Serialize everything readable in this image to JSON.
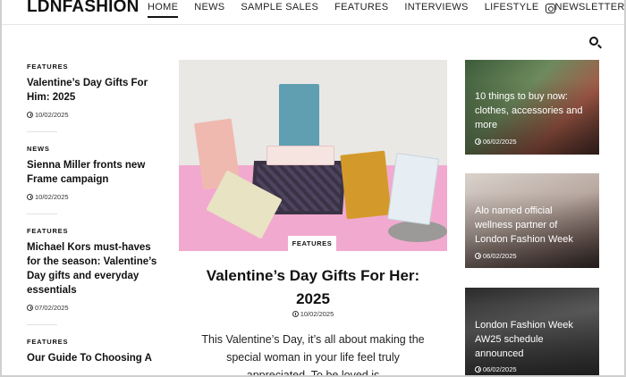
{
  "header": {
    "logo": "LDNFASHION",
    "nav": [
      "HOME",
      "NEWS",
      "SAMPLE SALES",
      "FEATURES",
      "INTERVIEWS",
      "LIFESTYLE",
      "NEWSLETTER"
    ],
    "active_nav": "HOME",
    "icons": [
      "instagram-icon",
      "search-icon"
    ]
  },
  "left_column": [
    {
      "category": "FEATURES",
      "title": "Valentine’s Day Gifts For Him: 2025",
      "date": "10/02/2025"
    },
    {
      "category": "NEWS",
      "title": "Sienna Miller fronts new Frame campaign",
      "date": "10/02/2025"
    },
    {
      "category": "FEATURES",
      "title": "Michael Kors must-haves for the season: Valentine’s Day gifts and everyday essentials",
      "date": "07/02/2025"
    },
    {
      "category": "FEATURES",
      "title": "Our Guide To Choosing A",
      "date": ""
    }
  ],
  "feature": {
    "category": "FEATURES",
    "title": "Valentine’s Day Gifts For Her: 2025",
    "date": "10/02/2025",
    "excerpt": "This Valentine’s Day, it’s all about making the special woman in your life feel truly appreciated. To be loved is"
  },
  "right_column": [
    {
      "title": "10 things to buy now: clothes, accessories and more",
      "date": "06/02/2025"
    },
    {
      "title": "Alo named official wellness partner of London Fashion Week",
      "date": "06/02/2025"
    },
    {
      "title": "London Fashion Week AW25 schedule announced",
      "date": "06/02/2025"
    }
  ],
  "colors": {
    "accent": "#111111",
    "pink_backdrop": "#f2a9cf"
  }
}
